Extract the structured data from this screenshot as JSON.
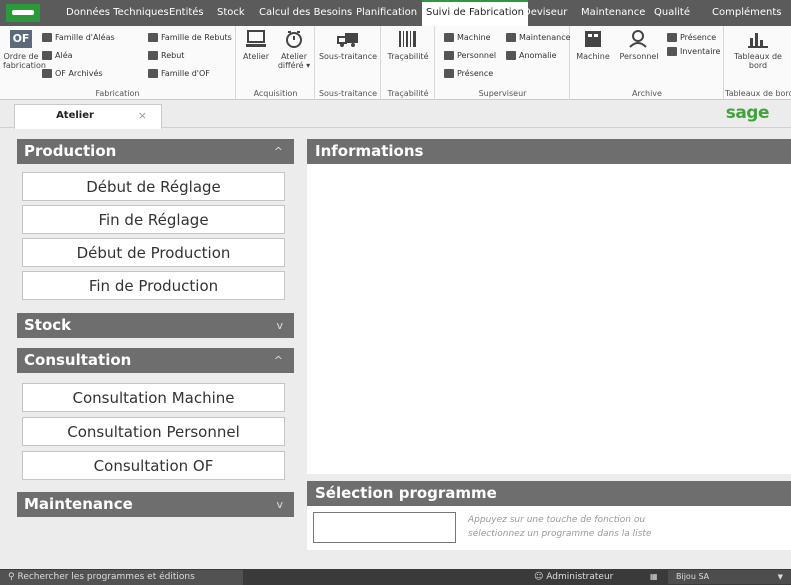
{
  "menu": {
    "tabs": [
      "Données Techniques",
      "Entités",
      "Stock",
      "Calcul des Besoins",
      "Planification",
      "Suivi de Fabrication",
      "Deviseur",
      "Maintenance",
      "Qualité",
      "Compléments"
    ],
    "active": "Suivi de Fabrication"
  },
  "ribbon": {
    "fabrication": {
      "label": "Fabrication",
      "ordre": "Ordre de fabrication",
      "ordre_icon": "OF",
      "famille_aleas": "Famille d'Aléas",
      "alea": "Aléa",
      "of_archives": "OF Archivés",
      "famille_rebuts": "Famille de Rebuts",
      "rebut": "Rebut",
      "famille_of": "Famille d'OF"
    },
    "acquisition": {
      "label": "Acquisition",
      "atelier": "Atelier",
      "atelier_differe_1": "Atelier",
      "atelier_differe_2": "différé"
    },
    "soustraitance": {
      "label": "Sous-traitance",
      "btn": "Sous-traitance"
    },
    "tracabilite": {
      "label": "Traçabilité",
      "btn": "Traçabilité"
    },
    "superviseur": {
      "label": "Superviseur",
      "machine": "Machine",
      "personnel": "Personnel",
      "presence": "Présence",
      "maintenance": "Maintenance",
      "anomalie": "Anomalie"
    },
    "archive": {
      "label": "Archive",
      "machine": "Machine",
      "personnel": "Personnel",
      "presence": "Présence",
      "inventaire": "Inventaire"
    },
    "tableaux": {
      "label": "Tableaux de bord",
      "btn_1": "Tableaux de",
      "btn_2": "bord"
    }
  },
  "doc_tab": {
    "title": "Atelier",
    "close": "×"
  },
  "brand": "sage",
  "left": {
    "production": {
      "title": "Production",
      "chev": "^",
      "items": [
        "Début de Réglage",
        "Fin de Réglage",
        "Début de Production",
        "Fin de Production"
      ]
    },
    "stock": {
      "title": "Stock",
      "chev": "v"
    },
    "consultation": {
      "title": "Consultation",
      "chev": "^",
      "items": [
        "Consultation Machine",
        "Consultation Personnel",
        "Consultation OF"
      ]
    },
    "maintenance": {
      "title": "Maintenance",
      "chev": "v"
    }
  },
  "right": {
    "informations": "Informations",
    "selection": "Sélection programme",
    "hint_1": "Appuyez sur une touche de fonction ou",
    "hint_2": "sélectionnez un programme dans la liste"
  },
  "status": {
    "search": "Rechercher les programmes et éditions",
    "user": "Administrateur",
    "company": "Bijou SA"
  },
  "colors": {
    "accent": "#2a9a3b",
    "header": "#6e6e6e",
    "menubar": "#5b5b5b",
    "brand": "#41a33b"
  }
}
